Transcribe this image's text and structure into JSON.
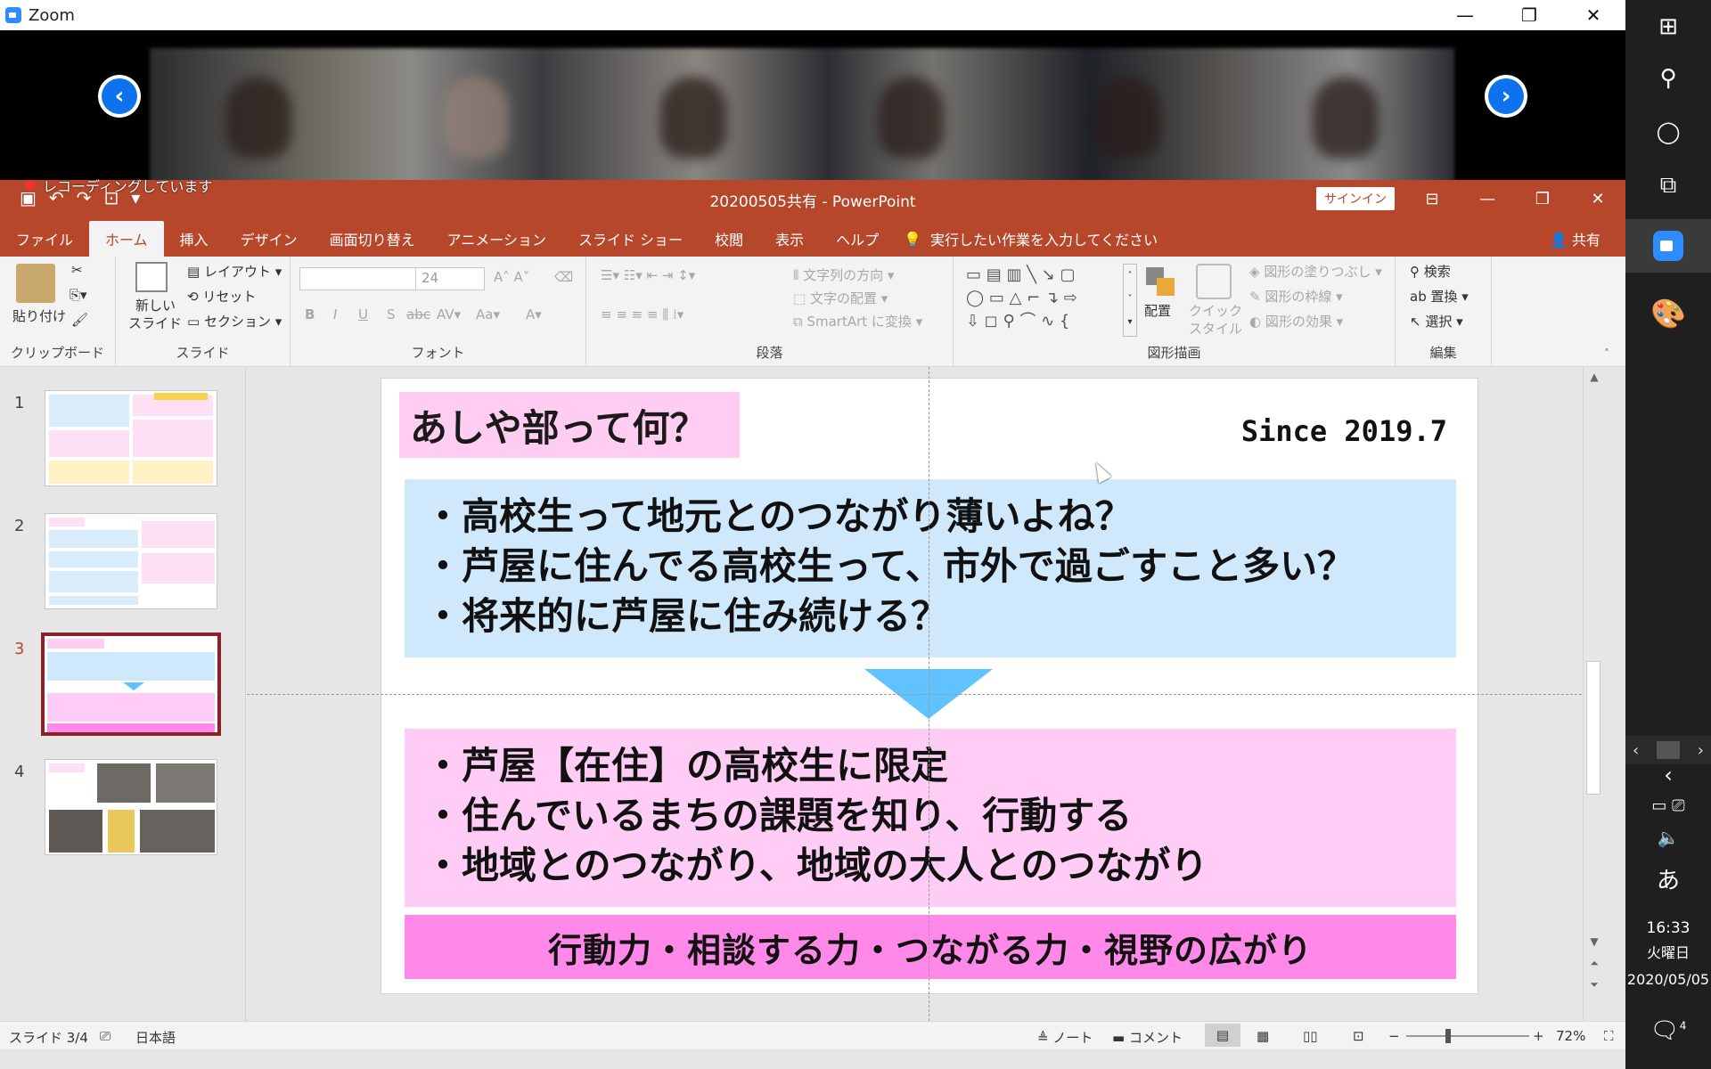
{
  "zoom": {
    "window_title": "Zoom",
    "recording_label": "レコーディングしています",
    "prev_glyph": "‹",
    "next_glyph": "›",
    "window_controls": [
      "—",
      "❐",
      "✕"
    ]
  },
  "powerpoint": {
    "doc_title": "20200505共有  -  PowerPoint",
    "signin_label": "サインイン",
    "window_controls": [
      "⊟",
      "—",
      "❐",
      "✕"
    ],
    "tabs": [
      "ファイル",
      "ホーム",
      "挿入",
      "デザイン",
      "画面切り替え",
      "アニメーション",
      "スライド ショー",
      "校閲",
      "表示",
      "ヘルプ"
    ],
    "active_tab": "ホーム",
    "tell_me": "実行したい作業を入力してください",
    "share_label": "共有",
    "ribbon": {
      "clipboard": {
        "paste": "貼り付け",
        "label": "クリップボード"
      },
      "slides": {
        "new_slide_line1": "新しい",
        "new_slide_line2": "スライド",
        "layout": "レイアウト",
        "reset": "リセット",
        "section": "セクション",
        "label": "スライド"
      },
      "font": {
        "size_value": "24",
        "label": "フォント"
      },
      "paragraph": {
        "text_direction": "文字列の方向",
        "align_text": "文字の配置",
        "smartart": "SmartArt に変換",
        "label": "段落"
      },
      "drawing": {
        "arrange": "配置",
        "quick_styles_line1": "クイック",
        "quick_styles_line2": "スタイル",
        "fill": "図形の塗りつぶし",
        "outline": "図形の枠線",
        "effects": "図形の効果",
        "label": "図形描画"
      },
      "editing": {
        "find": "検索",
        "replace": "置換",
        "select": "選択",
        "label": "編集"
      }
    },
    "thumbnails": [
      {
        "number": "1",
        "active": false
      },
      {
        "number": "2",
        "active": false
      },
      {
        "number": "3",
        "active": true
      },
      {
        "number": "4",
        "active": false
      }
    ],
    "slide": {
      "title": "あしや部って何？",
      "since": "Since 2019.7",
      "blue_bullets": [
        "・高校生って地元とのつながり薄いよね？",
        "・芦屋に住んでる高校生って、市外で過ごすこと多い？",
        "・将来的に芦屋に住み続ける？"
      ],
      "pink_bullets": [
        "・芦屋【在住】の高校生に限定",
        "・住んでいるまちの課題を知り、行動する",
        "・地域とのつながり、地域の大人とのつながり"
      ],
      "bottom_banner": "行動力・相談する力・つながる力・視野の広がり"
    },
    "status": {
      "slide_counter": "スライド 3/4",
      "language": "日本語",
      "notes": "ノート",
      "comments": "コメント",
      "zoom_level": "72%"
    }
  },
  "taskbar": {
    "clock_time": "16:33",
    "clock_day": "火曜日",
    "clock_date": "2020/05/05",
    "ime": "あ",
    "notifications": "4"
  }
}
